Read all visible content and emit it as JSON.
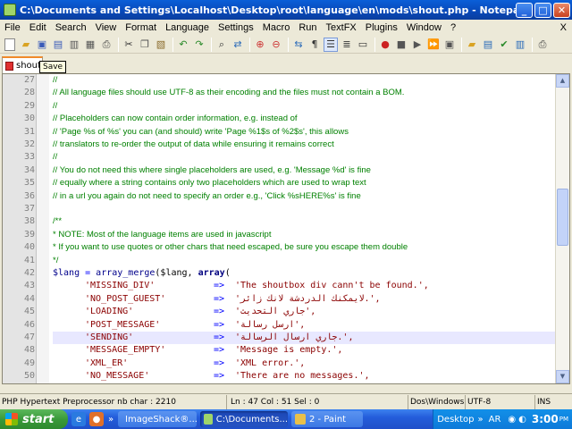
{
  "window": {
    "title": "C:\\Documents and Settings\\Localhost\\Desktop\\root\\language\\en\\mods\\shout.php - Notepad++",
    "minimize_label": "_",
    "maximize_label": "□",
    "close_label": "✕"
  },
  "menu": {
    "items": [
      "File",
      "Edit",
      "Search",
      "View",
      "Format",
      "Language",
      "Settings",
      "Macro",
      "Run",
      "TextFX",
      "Plugins",
      "Window",
      "?"
    ],
    "close_doc": "X"
  },
  "toolbar": {
    "icons": [
      "new-file-icon",
      "open-file-icon",
      "save-icon",
      "save-all-icon",
      "close-icon",
      "close-all-icon",
      "print-icon",
      "cut-icon",
      "copy-icon",
      "paste-icon",
      "undo-icon",
      "redo-icon",
      "find-icon",
      "replace-icon",
      "zoom-in-icon",
      "zoom-out-icon",
      "wrap-icon",
      "show-all-chars-icon",
      "indent-guide-icon",
      "user-lang-icon",
      "doc-map-icon",
      "record-macro-icon",
      "stop-macro-icon",
      "play-macro-icon",
      "run-macro-multiple-icon",
      "save-macro-icon",
      "sync-v-icon",
      "sync-h-icon",
      "spell-check-icon",
      "launch-browser-icon"
    ]
  },
  "tab": {
    "label": "shout",
    "tooltip": "Save"
  },
  "editor": {
    "line_numbers": [
      "27",
      "28",
      "29",
      "30",
      "31",
      "32",
      "33",
      "34",
      "35",
      "36",
      "37",
      "38",
      "39",
      "40",
      "41",
      "42",
      "43",
      "44",
      "45",
      "46",
      "47",
      "48",
      "49",
      "50"
    ],
    "current_line": "47",
    "lines": {
      "l27": "//",
      "l28": "// All language files should use UTF-8 as their encoding and the files must not contain a BOM.",
      "l29": "//",
      "l30": "// Placeholders can now contain order information, e.g. instead of",
      "l31": "// 'Page %s of %s' you can (and should) write 'Page %1$s of %2$s', this allows",
      "l32": "// translators to re-order the output of data while ensuring it remains correct",
      "l33": "//",
      "l34": "// You do not need this where single placeholders are used, e.g. 'Message %d' is fine",
      "l35": "// equally where a string contains only two placeholders which are used to wrap text",
      "l36": "// in a url you again do not need to specify an order e.g., 'Click %sHERE%s' is fine",
      "l37": "",
      "l38": "/**",
      "l39": "* NOTE: Most of the language items are used in javascript",
      "l40": "* If you want to use quotes or other chars that need escaped, be sure you escape them double",
      "l41": "*/",
      "l42_var": "$lang",
      "l42_eq": " = ",
      "l42_fn": "array_merge",
      "l42_mid": "($lang, ",
      "l42_arr": "array",
      "l42_end": "(",
      "entries": [
        {
          "key": "'MISSING_DIV'",
          "arrow": "=>",
          "value": "'The shoutbox div cann't be found.',"
        },
        {
          "key": "'NO_POST_GUEST'",
          "arrow": "=>",
          "value": "'لايمكنك الدردشة لانك زائر.',"
        },
        {
          "key": "'LOADING'",
          "arrow": "=>",
          "value": "'جاري التحديث',"
        },
        {
          "key": "'POST_MESSAGE'",
          "arrow": "=>",
          "value": "'ارسل رسالة',"
        },
        {
          "key": "'SENDING'",
          "arrow": "=>",
          "value": "'جاري ارسال الرسالة.',"
        },
        {
          "key": "'MESSAGE_EMPTY'",
          "arrow": "=>",
          "value": "'Message is empty.',"
        },
        {
          "key": "'XML_ER'",
          "arrow": "=>",
          "value": "'XML error.',"
        },
        {
          "key": "'NO_MESSAGE'",
          "arrow": "=>",
          "value": "'There are no messages.',"
        }
      ]
    }
  },
  "statusbar": {
    "lang": "PHP Hypertext Preprocessor  nb char : 2210",
    "position": "Ln : 47   Col : 51   Sel : 0",
    "eol": "Dos\\Windows",
    "encoding": "UTF-8",
    "mode": "INS"
  },
  "taskbar": {
    "start_label": "start",
    "tasks": [
      "ImageShack®...",
      "C:\\Documents...",
      "2 - Paint"
    ],
    "desktop_label": "Desktop",
    "lang_indicator": "AR",
    "clock": "3:00",
    "clock_suffix": "PM"
  },
  "colors": {
    "comment": "#008000",
    "keyword": "#00008b",
    "string": "#8b0000",
    "operator": "#0000ff",
    "current_line": "#e8e8ff",
    "titlebar": "#0a5fd8",
    "tab_accent": "#f08a2a"
  }
}
